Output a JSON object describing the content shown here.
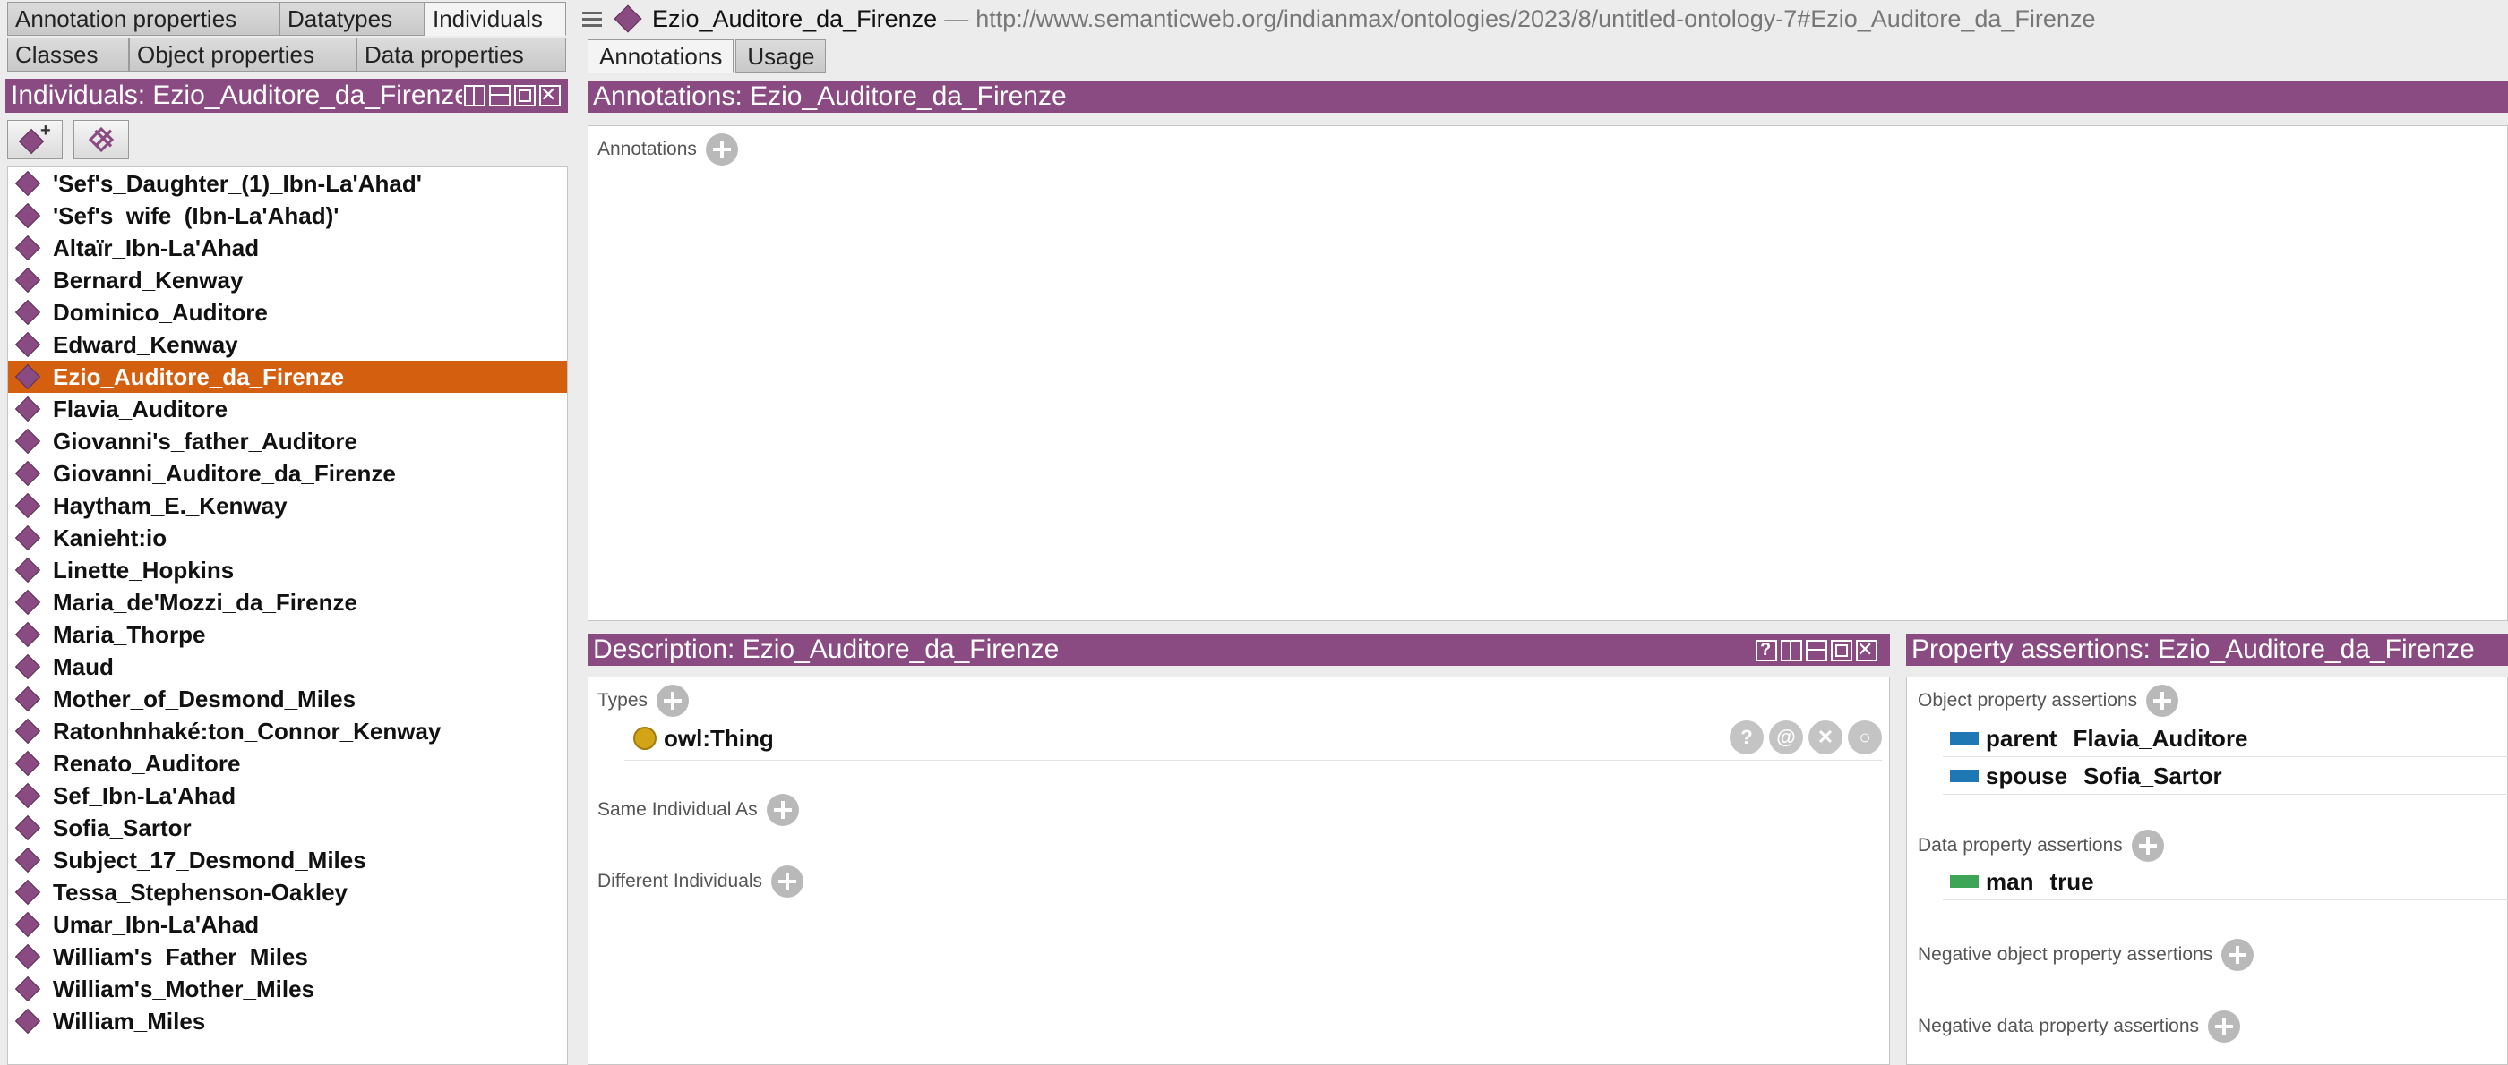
{
  "left_tabs": {
    "row1": [
      "Annotation properties",
      "Datatypes",
      "Individuals"
    ],
    "row2": [
      "Classes",
      "Object properties",
      "Data properties"
    ]
  },
  "left_header": "Individuals: Ezio_Auditore_da_Firenze",
  "individuals": [
    "'Sef's_Daughter_(1)_Ibn-La'Ahad'",
    "'Sef's_wife_(Ibn-La'Ahad)'",
    "Altaïr_Ibn-La'Ahad",
    "Bernard_Kenway",
    "Dominico_Auditore",
    "Edward_Kenway",
    "Ezio_Auditore_da_Firenze",
    "Flavia_Auditore",
    "Giovanni's_father_Auditore",
    "Giovanni_Auditore_da_Firenze",
    "Haytham_E._Kenway",
    "Kanieht:io",
    "Linette_Hopkins",
    "Maria_de'Mozzi_da_Firenze",
    "Maria_Thorpe",
    "Maud",
    "Mother_of_Desmond_Miles",
    "Ratonhnhaké:ton_Connor_Kenway",
    "Renato_Auditore",
    "Sef_Ibn-La'Ahad",
    "Sofia_Sartor",
    "Subject_17_Desmond_Miles",
    "Tessa_Stephenson-Oakley",
    "Umar_Ibn-La'Ahad",
    "William's_Father_Miles",
    "William's_Mother_Miles",
    "William_Miles"
  ],
  "selected_index": 6,
  "title": {
    "entity": "Ezio_Auditore_da_Firenze",
    "separator": "—",
    "iri": "http://www.semanticweb.org/indianmax/ontologies/2023/8/untitled-ontology-7#Ezio_Auditore_da_Firenze"
  },
  "right_tabs": [
    "Annotations",
    "Usage"
  ],
  "annotations": {
    "header": "Annotations: Ezio_Auditore_da_Firenze",
    "label": "Annotations"
  },
  "description": {
    "header": "Description: Ezio_Auditore_da_Firenze",
    "types_label": "Types",
    "type_value": "owl:Thing",
    "row_buttons": [
      "?",
      "@",
      "✕",
      "○"
    ],
    "same_label": "Same Individual As",
    "different_label": "Different Individuals"
  },
  "property_assertions": {
    "header": "Property assertions: Ezio_Auditore_da_Firenze",
    "object_label": "Object property assertions",
    "object_rows": [
      {
        "property": "parent",
        "value": "Flavia_Auditore"
      },
      {
        "property": "spouse",
        "value": "Sofia_Sartor"
      }
    ],
    "data_label": "Data property assertions",
    "data_rows": [
      {
        "property": "man",
        "value": "true"
      }
    ],
    "neg_object_label": "Negative object property assertions",
    "neg_data_label": "Negative data property assertions"
  },
  "colors": {
    "header_purple": "#8a4a82",
    "selection_orange": "#d35f0f",
    "object_property_blue": "#1f78b4",
    "data_property_green": "#3fa556",
    "class_yellow": "#d4a417"
  }
}
